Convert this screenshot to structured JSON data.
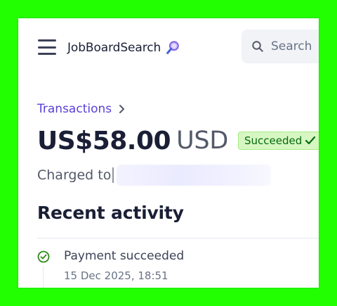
{
  "header": {
    "menu_icon": "hamburger-menu-icon",
    "brand_name": "JobBoardSearch",
    "brand_icon": "magnifier-icon",
    "search_placeholder": "Search",
    "search_icon": "search-icon"
  },
  "breadcrumb": {
    "label": "Transactions",
    "chevron_icon": "chevron-right-icon"
  },
  "payment": {
    "amount": "US$58.00",
    "currency": "USD",
    "status": "Succeeded",
    "status_icon": "checkmark-icon",
    "charged_to_label": "Charged to"
  },
  "activity": {
    "title": "Recent activity",
    "events": [
      {
        "title": "Payment succeeded",
        "time": "15 Dec 2025, 18:51",
        "icon": "check-circle-icon"
      }
    ]
  },
  "colors": {
    "background": "#22ff00",
    "link": "#5a3fd6",
    "success_bg": "#d7f7c2",
    "success_text": "#05690d",
    "text_primary": "#1a1f36"
  }
}
